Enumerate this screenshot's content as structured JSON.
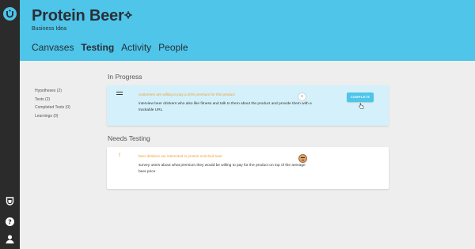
{
  "app": {
    "title": "Protein Beer",
    "subtitle": "Business Idea"
  },
  "tabs": [
    {
      "label": "Canvases",
      "active": false
    },
    {
      "label": "Testing",
      "active": true
    },
    {
      "label": "Activity",
      "active": false
    },
    {
      "label": "People",
      "active": false
    }
  ],
  "sidebar": {
    "items": [
      {
        "label": "Hypotheses (2)"
      },
      {
        "label": "Tests (2)"
      },
      {
        "label": "Completed Tests (0)"
      },
      {
        "label": "Learnings (0)"
      }
    ]
  },
  "in_progress": {
    "title": "In Progress",
    "card": {
      "hypothesis": "customers are willing to pay a 20% premium for this product",
      "description": "interview beer drinkers who also like fitness and talk to them about the product and provide them with a trackable URL",
      "button_label": "COMPLETE"
    }
  },
  "needs_testing": {
    "title": "Needs Testing",
    "card": {
      "marker": "!",
      "hypothesis": "beer drinkers are interested in protein enriched beer",
      "description": "survey users about what premium they would be willing to pay for the product on top of the average beer price"
    }
  },
  "rail": {
    "icons": [
      "logo-icon",
      "shield-icon",
      "help-icon",
      "user-icon"
    ]
  },
  "colors": {
    "header": "#4ec5e9",
    "rail": "#2b2b2b",
    "in_progress_card": "#d4f0fa",
    "hypothesis_text": "#f0a030"
  }
}
